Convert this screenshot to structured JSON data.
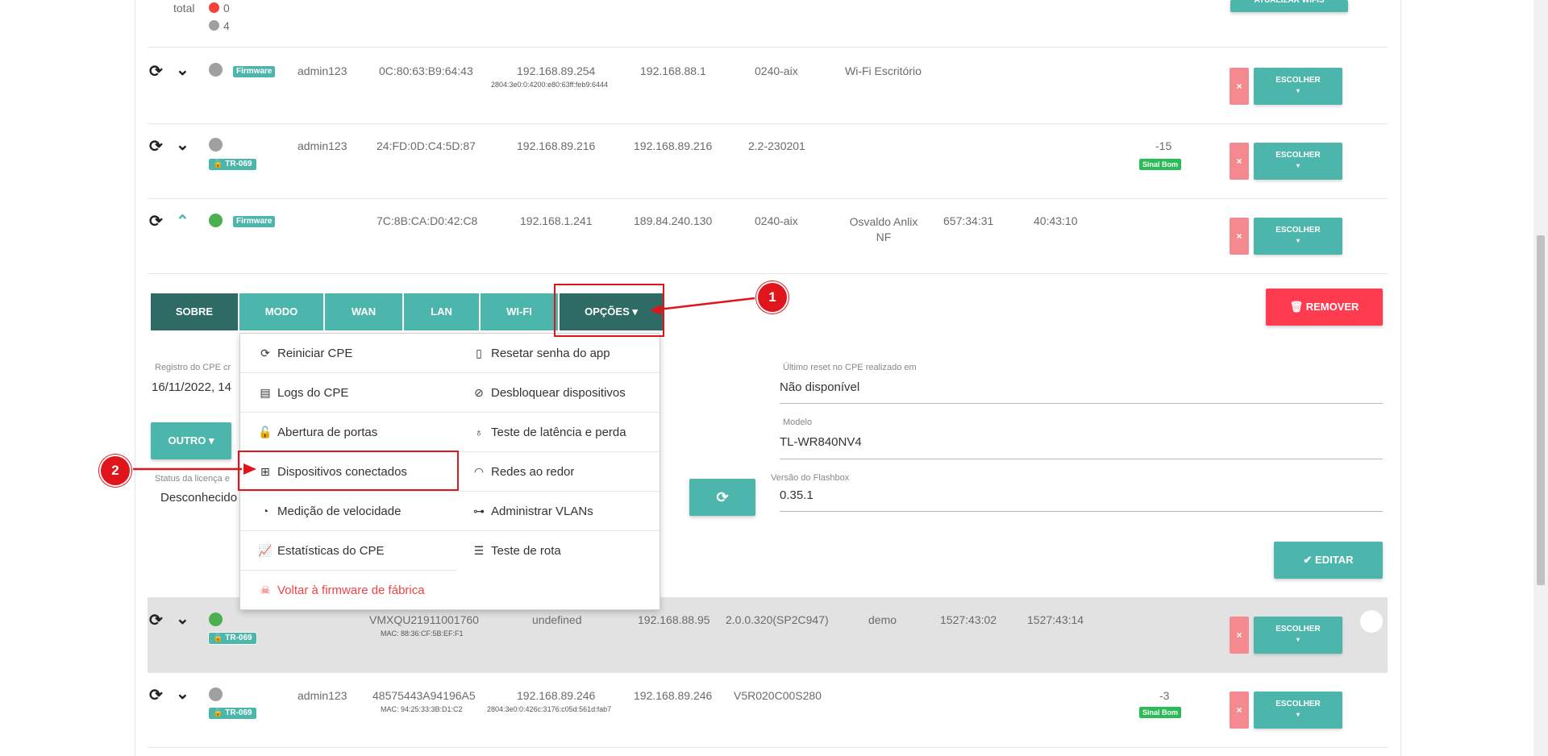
{
  "top": {
    "total_label": "total",
    "count_red": "0",
    "count_gray": "4",
    "update_button": "ATUALIZAR WIFIS"
  },
  "rows": [
    {
      "tag": "Firmware",
      "user": "admin123",
      "mac": "0C:80:63:B9:64:43",
      "ip": "192.168.89.254",
      "ip_sub": "2804:3e0:0:4200:e80:63ff:feb9:6444",
      "wan_ip": "192.168.88.1",
      "version": "0240-aix",
      "name": "Wi-Fi Escritório"
    },
    {
      "tag": "TR-069",
      "user": "admin123",
      "mac": "24:FD:0D:C4:5D:87",
      "ip": "192.168.89.216",
      "wan_ip": "192.168.89.216",
      "version": "2.2-230201",
      "signal": "-15",
      "signal_badge": "Sinal Bom"
    },
    {
      "tag": "Firmware",
      "mac": "7C:8B:CA:D0:42:C8",
      "ip": "192.168.1.241",
      "wan_ip": "189.84.240.130",
      "version": "0240-aix",
      "name": "Osvaldo Anlix NF",
      "uptime1": "657:34:31",
      "uptime2": "40:43:10"
    },
    {
      "tag": "TR-069",
      "mac": "VMXQU21911001760",
      "mac_sub": "MAC: 88:36:CF:5B:EF:F1",
      "ip": "undefined",
      "wan_ip": "192.168.88.95",
      "version": "2.0.0.320(SP2C947)",
      "name": "demo",
      "uptime1": "1527:43:02",
      "uptime2": "1527:43:14"
    },
    {
      "tag": "TR-069",
      "user": "admin123",
      "mac": "48575443A94196A5",
      "mac_sub": "MAC: 94:25:33:3B:D1:C2",
      "ip": "192.168.89.246",
      "ip_sub": "2804:3e0:0:426c:3176:c05d:561d:fab7",
      "wan_ip": "192.168.89.246",
      "version": "V5R020C00S280",
      "signal": "-3",
      "signal_badge": "Sinal Bom"
    }
  ],
  "row_buttons": {
    "remove_x": "×",
    "choose": "ESCOLHER",
    "choose_caret": "▾"
  },
  "tabs": [
    "SOBRE",
    "MODO",
    "WAN",
    "LAN",
    "WI-FI",
    "OPÇÕES ▾"
  ],
  "remove_button": "REMOVER",
  "fields": {
    "reg_label": "Registro do CPE cr",
    "reg_value": "16/11/2022, 14",
    "reset_label": "Último reset no CPE realizado em",
    "reset_value": "Não disponível",
    "model_label": "Modelo",
    "model_value": "TL-WR840NV4",
    "flashbox_label": "Versão do Flashbox",
    "flashbox_value": "0.35.1",
    "license_label": "Status da licença e",
    "license_value": "Desconhecido"
  },
  "outro_button": "OUTRO ▾",
  "edit_button": "EDITAR",
  "menu": {
    "left": [
      "Reiniciar CPE",
      "Logs do CPE",
      "Abertura de portas",
      "Dispositivos conectados",
      "Medição de velocidade",
      "Estatísticas do CPE",
      "Voltar à firmware de fábrica"
    ],
    "right": [
      "Resetar senha do app",
      "Desbloquear dispositivos",
      "Teste de latência e perda",
      "Redes ao redor",
      "Administrar VLANs",
      "Teste de rota"
    ]
  },
  "callouts": [
    "1",
    "2"
  ],
  "colors": {
    "teal": "#4db6ac",
    "dark_teal": "#2f6b65",
    "red": "#ff3b4f",
    "annotation": "#e0151c"
  }
}
